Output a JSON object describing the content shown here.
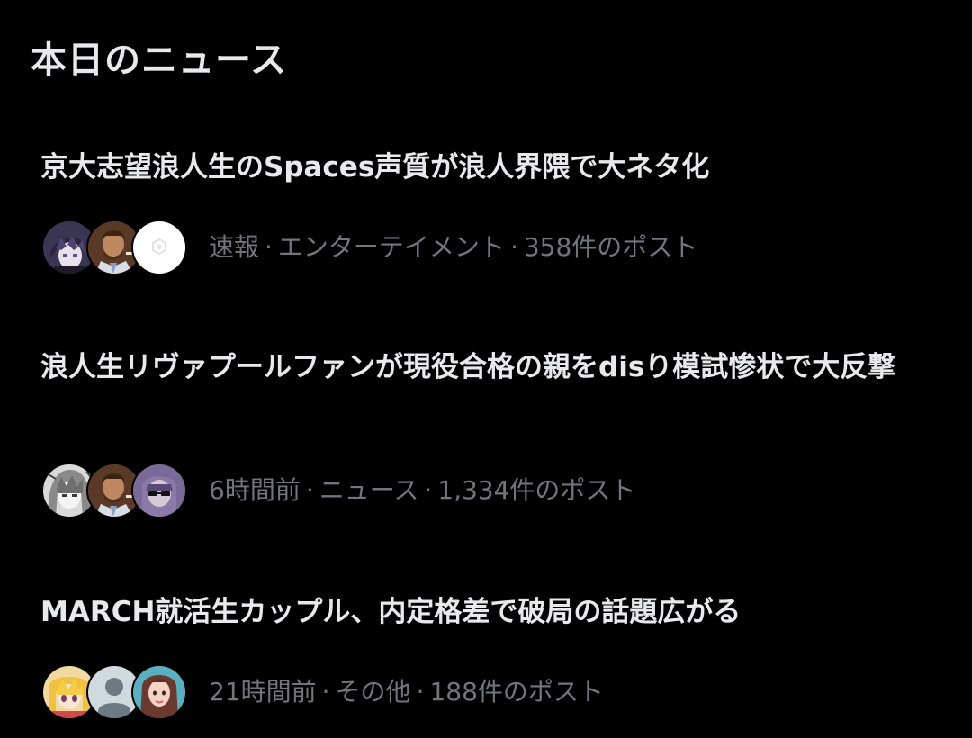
{
  "section": {
    "title": "本日のニュース"
  },
  "news": [
    {
      "headline": "京大志望浪人生のSpaces声質が浪人界隈で大ネタ化",
      "time": "速報",
      "category": "エンターテイメント",
      "posts": "358件のポスト",
      "avatars": [
        "anime-boy-avatar",
        "man-portrait-avatar",
        "white-logo-avatar"
      ]
    },
    {
      "headline": "浪人生リヴァプールファンが現役合格の親をdisり模試惨状で大反撃",
      "time": "6時間前",
      "category": "ニュース",
      "posts": "1,334件のポスト",
      "avatars": [
        "manga-girl-avatar",
        "man-portrait-avatar",
        "sunglasses-avatar"
      ]
    },
    {
      "headline": "MARCH就活生カップル、内定格差で破局の話題広がる",
      "time": "21時間前",
      "category": "その他",
      "posts": "188件のポスト",
      "avatars": [
        "blonde-anime-girl-avatar",
        "default-user-avatar",
        "woman-portrait-avatar"
      ]
    }
  ],
  "meta_separator": "·",
  "colors": {
    "background": "#000000",
    "primary_text": "#e7e9ea",
    "secondary_text": "#71767b"
  }
}
